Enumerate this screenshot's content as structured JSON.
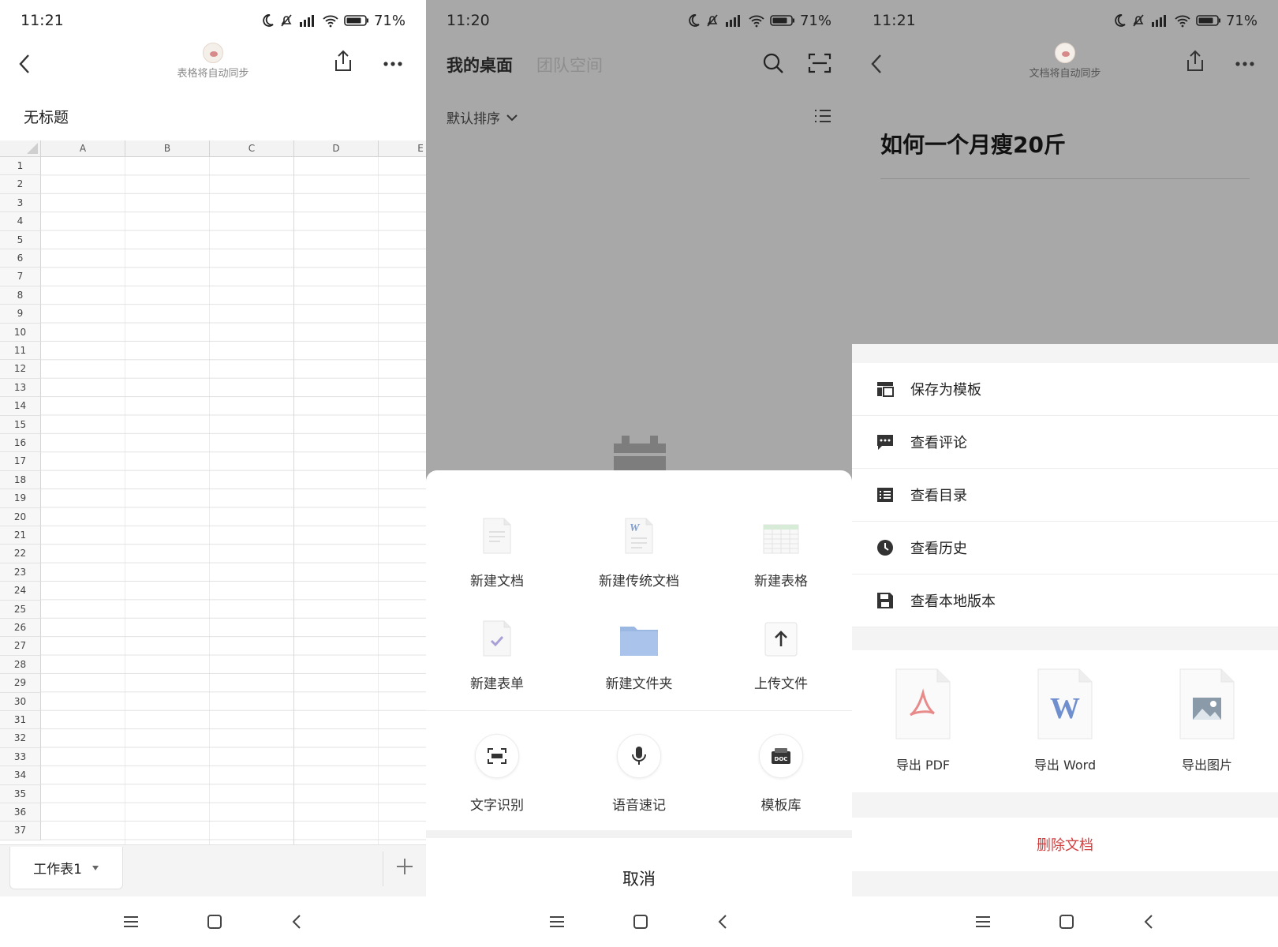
{
  "screens": {
    "sheet": {
      "status": {
        "time": "11:21",
        "battery": "71%"
      },
      "sync_text": "表格将自动同步",
      "doc_title": "无标题",
      "columns": [
        "A",
        "B",
        "C",
        "D",
        "E"
      ],
      "rows": [
        "1",
        "2",
        "3",
        "4",
        "5",
        "6",
        "7",
        "8",
        "9",
        "10",
        "11",
        "12",
        "13",
        "14",
        "15",
        "16",
        "17",
        "18",
        "19",
        "20",
        "21",
        "22",
        "23",
        "24",
        "25",
        "26",
        "27",
        "28",
        "29",
        "30",
        "31",
        "32",
        "33",
        "34",
        "35",
        "36",
        "37"
      ],
      "sheet_tab": "工作表1"
    },
    "desktop": {
      "status": {
        "time": "11:20",
        "battery": "71%"
      },
      "tabs": [
        "我的桌面",
        "团队空间"
      ],
      "sort_label": "默认排序",
      "create_items": [
        "新建文档",
        "新建传统文档",
        "新建表格",
        "新建表单",
        "新建文件夹",
        "上传文件"
      ],
      "tool_items": [
        "文字识别",
        "语音速记",
        "模板库"
      ],
      "doc_badge": "DOC",
      "word_badge": "W",
      "cancel": "取消"
    },
    "doc": {
      "status": {
        "time": "11:21",
        "battery": "71%"
      },
      "sync_text": "文档将自动同步",
      "title": "如何一个月瘦20斤",
      "menu": [
        "保存为模板",
        "查看评论",
        "查看目录",
        "查看历史",
        "查看本地版本"
      ],
      "exports": [
        "导出 PDF",
        "导出 Word",
        "导出图片"
      ],
      "word_badge": "W",
      "delete": "删除文档"
    }
  },
  "colors": {
    "accent_red": "#d23f3f",
    "overlay": "#a8a8a8",
    "folder_blue": "#9bb8e2"
  }
}
